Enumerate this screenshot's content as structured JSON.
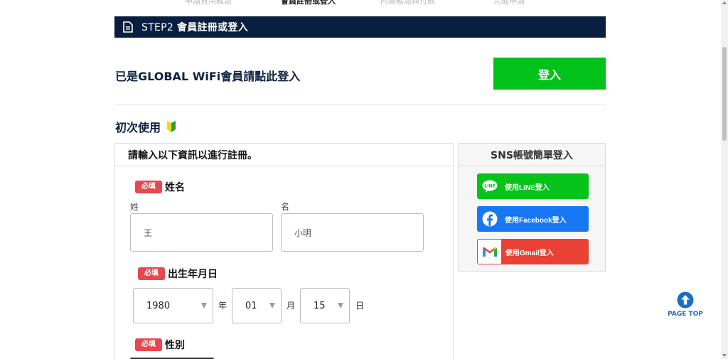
{
  "steps": [
    {
      "label": "申請資用確認",
      "active": false
    },
    {
      "label": "會員註冊或登入",
      "active": true
    },
    {
      "label": "內容確認與付款",
      "active": false
    },
    {
      "label": "完成申請",
      "active": false
    }
  ],
  "step_bar": {
    "prefix": "STEP2 ",
    "title": "會員註冊或登入"
  },
  "login": {
    "text": "已是GLOBAL WiFi會員請點此登入",
    "button": "登入"
  },
  "first_time": {
    "title": "初次使用"
  },
  "registration": {
    "header": "請輸入以下資訊以進行註冊。",
    "required_badge": "必填",
    "name": {
      "title": "姓名",
      "last_label": "姓",
      "last_value": "王",
      "first_label": "名",
      "first_value": "小明"
    },
    "birth": {
      "title": "出生年月日",
      "year": "1980",
      "year_unit": "年",
      "month": "01",
      "month_unit": "月",
      "day": "15",
      "day_unit": "日"
    },
    "gender": {
      "title": "性別"
    }
  },
  "sns": {
    "title": "SNS帳號簡單登入",
    "line": "使用LINE登入",
    "line_icon_text": "LINE",
    "facebook": "使用Facebook登入",
    "gmail": "使用Gmail登入"
  },
  "page_top": {
    "label": "PAGE TOP"
  },
  "colors": {
    "navy": "#0a1e3f",
    "green": "#00c21a",
    "line_green": "#06c31a",
    "facebook_blue": "#1877f2",
    "gmail_red": "#e94235",
    "required_red": "#e8474f",
    "page_top_blue": "#1a6fc1"
  }
}
